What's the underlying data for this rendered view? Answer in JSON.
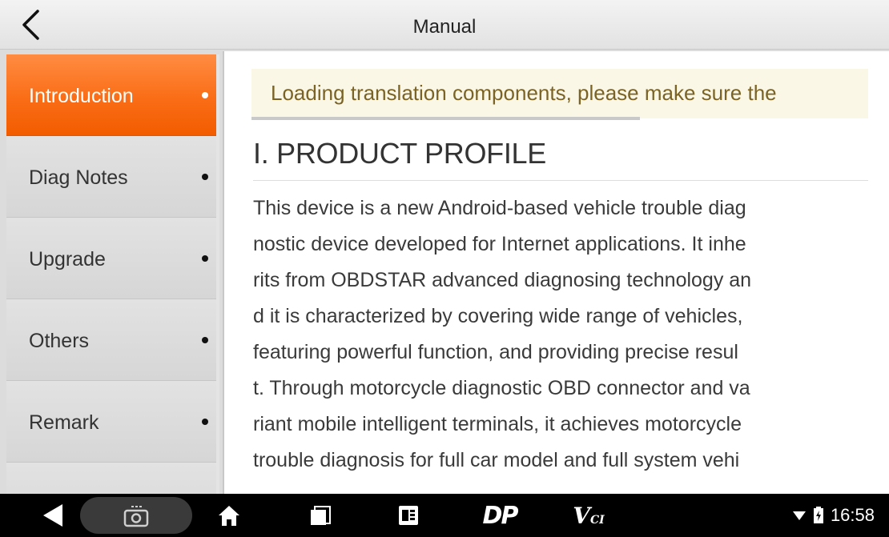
{
  "header": {
    "title": "Manual",
    "back_icon": "chevron-left-icon"
  },
  "sidebar": {
    "items": [
      {
        "label": "Introduction",
        "active": true
      },
      {
        "label": "Diag Notes",
        "active": false
      },
      {
        "label": "Upgrade",
        "active": false
      },
      {
        "label": "Others",
        "active": false
      },
      {
        "label": "Remark",
        "active": false
      }
    ]
  },
  "content": {
    "notice": "Loading translation components, please make sure the",
    "loading_progress": 0.63,
    "section_title": "I. PRODUCT PROFILE",
    "paragraph_lines": [
      "This device is a new Android-based vehicle trouble diag",
      "nostic device developed for Internet applications. It inhe",
      "rits from OBDSTAR advanced diagnosing technology an",
      "d it is characterized by covering wide range of vehicles,",
      "featuring powerful function, and providing precise resul",
      "t. Through motorcycle diagnostic OBD connector and va",
      "riant mobile intelligent terminals, it achieves motorcycle",
      "trouble diagnosis for full car model and full system vehi"
    ]
  },
  "navbar": {
    "items": [
      "back-icon",
      "screenshot-camera-icon",
      "home-icon",
      "recents-icon",
      "app-shortcut-icon",
      "dp-logo",
      "vci-logo"
    ],
    "dp_label": "DP",
    "vci_label": "V",
    "vci_sub": "CI",
    "time": "16:58"
  },
  "colors": {
    "accent": "#f26a1b",
    "notice_text": "#7a6325",
    "notice_bg": "#fbf7e6"
  }
}
